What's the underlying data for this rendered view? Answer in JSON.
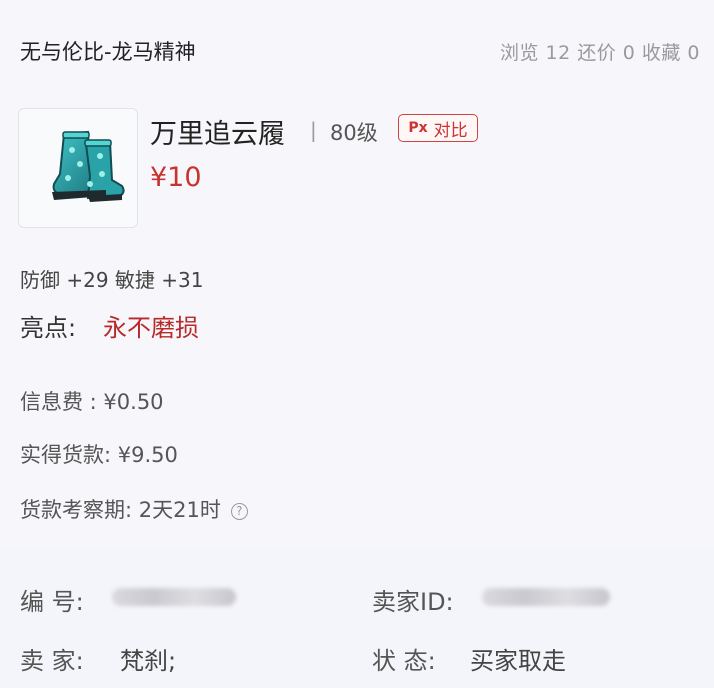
{
  "header": {
    "shop_name": "无与伦比-龙马精神",
    "stats": "浏览 12 还价 0 收藏 0"
  },
  "item": {
    "icon": "green-boots-icon",
    "name": "万里追云履",
    "separator": "|",
    "level": "80级",
    "compare_label": "对比",
    "compare_icon_text": "Px",
    "price": "¥10",
    "attributes": "防御 +29 敏捷 +31",
    "highlight_label": "亮点:",
    "highlight_value": "永不磨损"
  },
  "fees": {
    "info_fee": "信息费 : ¥0.50",
    "net_payment": "实得货款:  ¥9.50",
    "review_period": "货款考察期:  2天21时"
  },
  "details": {
    "id_label": "编   号:",
    "seller_id_label": "卖家ID:",
    "seller_label": "卖   家:",
    "seller_value": "梵刹;",
    "status_label": "状   态:",
    "status_value": "买家取走"
  },
  "colors": {
    "price": "#c8322f",
    "highlight": "#b82a2a",
    "compare_border": "#cc4444"
  }
}
